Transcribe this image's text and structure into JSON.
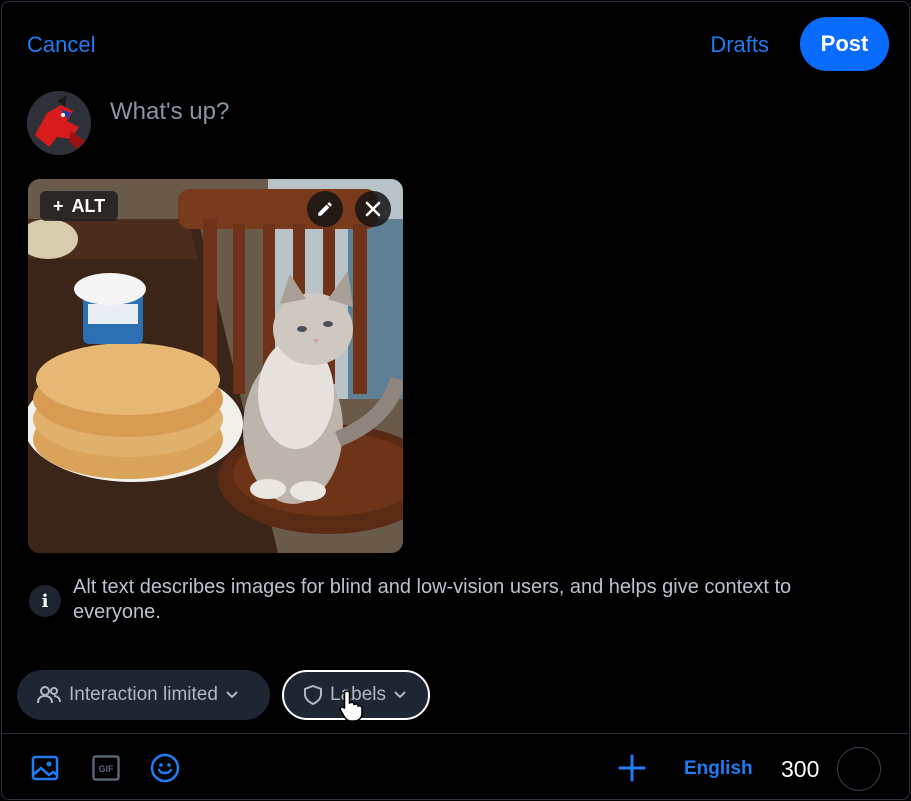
{
  "header": {
    "cancel_label": "Cancel",
    "drafts_label": "Drafts",
    "post_label": "Post"
  },
  "composer": {
    "placeholder": "What's up?"
  },
  "media": {
    "alt_label": "ALT",
    "alt_plus": "+"
  },
  "info": {
    "text": "Alt text describes images for blind and low-vision users, and helps give context to everyone."
  },
  "chips": {
    "interaction_label": "Interaction limited",
    "labels_label": "Labels"
  },
  "toolbar": {
    "language_label": "English",
    "char_count": "300"
  },
  "colors": {
    "accent": "#0a6cff",
    "link": "#1f7cf2",
    "background": "#000000"
  }
}
